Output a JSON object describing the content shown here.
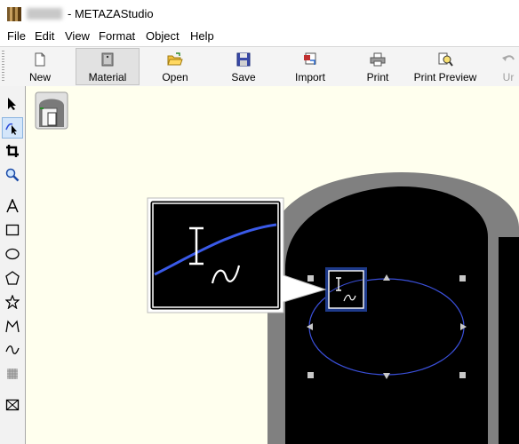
{
  "window": {
    "title": "- METAZAStudio"
  },
  "menu": [
    "File",
    "Edit",
    "View",
    "Format",
    "Object",
    "Help"
  ],
  "toolbar": {
    "buttons": [
      {
        "label": "New",
        "icon": "new-document-icon"
      },
      {
        "label": "Material",
        "icon": "material-icon"
      },
      {
        "label": "Open",
        "icon": "open-folder-icon"
      },
      {
        "label": "Save",
        "icon": "save-disk-icon"
      },
      {
        "label": "Import",
        "icon": "import-icon"
      },
      {
        "label": "Print",
        "icon": "printer-icon"
      },
      {
        "label": "Print Preview",
        "icon": "print-preview-icon"
      },
      {
        "label": "Ur",
        "icon": "undo-icon"
      }
    ]
  },
  "tools": [
    "select-arrow-icon",
    "node-edit-icon",
    "crop-icon",
    "zoom-icon",
    "text-icon",
    "rectangle-icon",
    "ellipse-icon",
    "pentagon-icon",
    "star-icon",
    "polyline-icon",
    "curve-icon",
    "pattern-icon",
    "image-frame-icon"
  ],
  "colors": {
    "canvas": "#ffffee",
    "material_gray": "#808080",
    "material_black": "#000000",
    "selection_blue": "#3a4fd8",
    "callout_frame": "#1e3a8a"
  }
}
